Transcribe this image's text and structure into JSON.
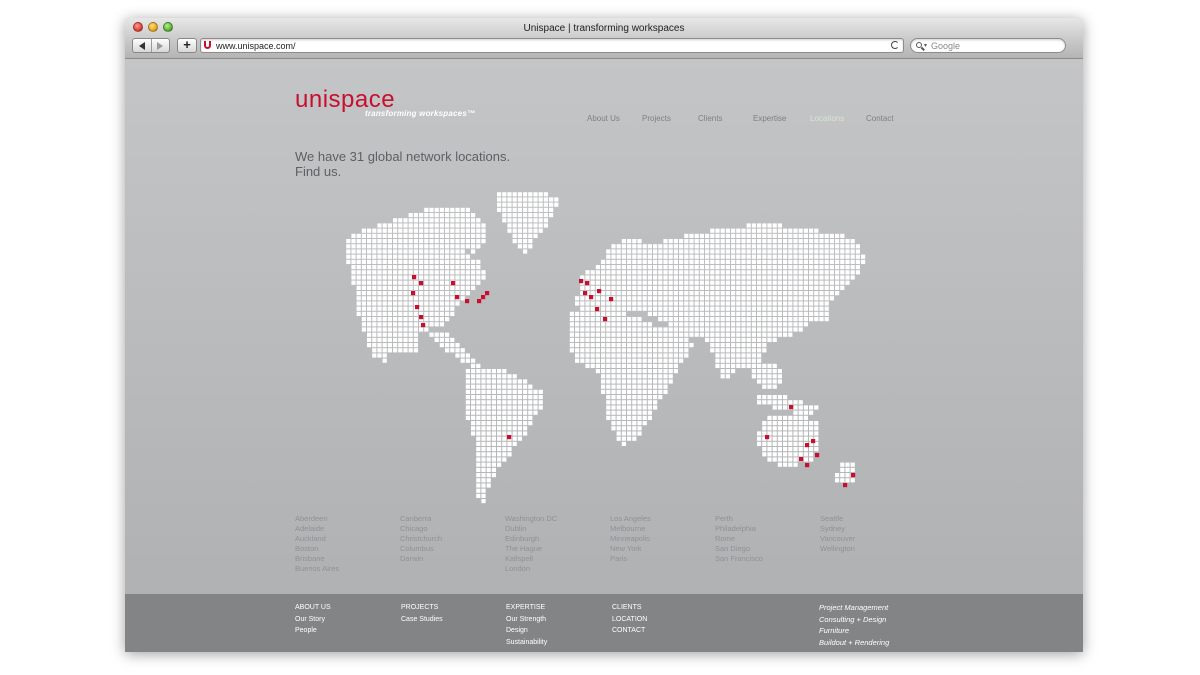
{
  "browser": {
    "title": "Unispace | transforming workspaces",
    "url": "www.unispace.com/",
    "search_placeholder": "Google"
  },
  "site": {
    "logo": "unispace",
    "tagline": "transforming workspaces™",
    "brand_color": "#c8102e",
    "nav": [
      {
        "label": "About Us",
        "active": false
      },
      {
        "label": "Projects",
        "active": false
      },
      {
        "label": "Clients",
        "active": false
      },
      {
        "label": "Expertise",
        "active": false
      },
      {
        "label": "Locations",
        "active": true
      },
      {
        "label": "Contact",
        "active": false
      }
    ],
    "headline_line1": "We have 31 global network locations.",
    "headline_line2": "Find us.",
    "map": {
      "dot_color": "#ffffff",
      "office_marker_color": "#c8102e"
    },
    "cities": [
      [
        "Aberdeen",
        "Adelaide",
        "Auckland",
        "Boston",
        "Brisbane",
        "Buenos Aires"
      ],
      [
        "Canberra",
        "Chicago",
        "Christchurch",
        "Columbus",
        "Darwin"
      ],
      [
        "Washington DC",
        "Dublin",
        "Edinburgh",
        "The Hague",
        "Kallspell",
        "London"
      ],
      [
        "Los Angeles",
        "Melbourne",
        "Minneapolis",
        "New York",
        "Paris"
      ],
      [
        "Perth",
        "Philadelphia",
        "Rome",
        "San Diego",
        "San Francisco"
      ],
      [
        "Seattle",
        "Sydney",
        "Vancouver",
        "Wellington"
      ]
    ],
    "footer": {
      "col1": {
        "head": "ABOUT US",
        "links": [
          "Our Story",
          "People"
        ]
      },
      "col2": {
        "head": "PROJECTS",
        "links": [
          "Case Studies"
        ]
      },
      "col3": {
        "head": "EXPERTISE",
        "links": [
          "Our Strength",
          "Design",
          "Sustainability"
        ]
      },
      "col4": {
        "links": [
          "CLIENTS",
          "LOCATION",
          "CONTACT"
        ]
      },
      "services": [
        "Project Management",
        "Consulting + Design",
        "Furniture",
        "Buildout + Rendering"
      ]
    }
  }
}
